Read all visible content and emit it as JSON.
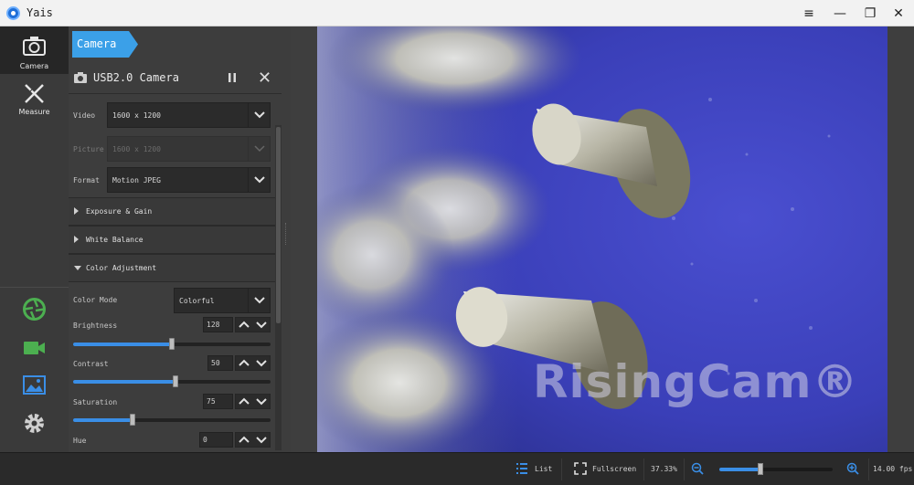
{
  "window": {
    "title": "Yais",
    "controls": {
      "menu": "≡",
      "minimize": "—",
      "maximize": "❐",
      "close": "✕"
    }
  },
  "rail": {
    "items": [
      {
        "label": "Camera",
        "icon": "camera-icon",
        "active": true
      },
      {
        "label": "Measure",
        "icon": "measure-icon",
        "active": false
      }
    ],
    "tools": [
      {
        "icon": "aperture-icon",
        "color": "#4caf50"
      },
      {
        "icon": "video-icon",
        "color": "#4caf50"
      },
      {
        "icon": "image-icon",
        "color": "#3a8ee6"
      },
      {
        "icon": "settings-icon",
        "color": "#cfcfcf"
      }
    ]
  },
  "panel": {
    "breadcrumb": "Camera",
    "device_title": "USB2.0 Camera",
    "video": {
      "label": "Video",
      "value": "1600 x 1200"
    },
    "picture": {
      "label": "Picture",
      "value": "1600 x 1200"
    },
    "format": {
      "label": "Format",
      "value": "Motion JPEG"
    },
    "sections": {
      "exposure": "Exposure & Gain",
      "white_balance": "White Balance",
      "color_adjustment": "Color Adjustment"
    },
    "color_mode": {
      "label": "Color Mode",
      "value": "Colorful"
    },
    "brightness": {
      "label": "Brightness",
      "value": "128",
      "fraction": 0.5
    },
    "contrast": {
      "label": "Contrast",
      "value": "50",
      "fraction": 0.52
    },
    "saturation": {
      "label": "Saturation",
      "value": "75",
      "fraction": 0.3
    },
    "hue": {
      "label": "Hue",
      "value": "0"
    }
  },
  "viewer": {
    "watermark": "RisingCam®"
  },
  "status": {
    "list_label": "List",
    "fullscreen_label": "Fullscreen",
    "zoom_level": "37.33%",
    "zoom_fraction": 0.36,
    "fps": "14.00 fps"
  },
  "colors": {
    "accent": "#3a8ee6",
    "breadcrumb": "#3ba0e8"
  }
}
